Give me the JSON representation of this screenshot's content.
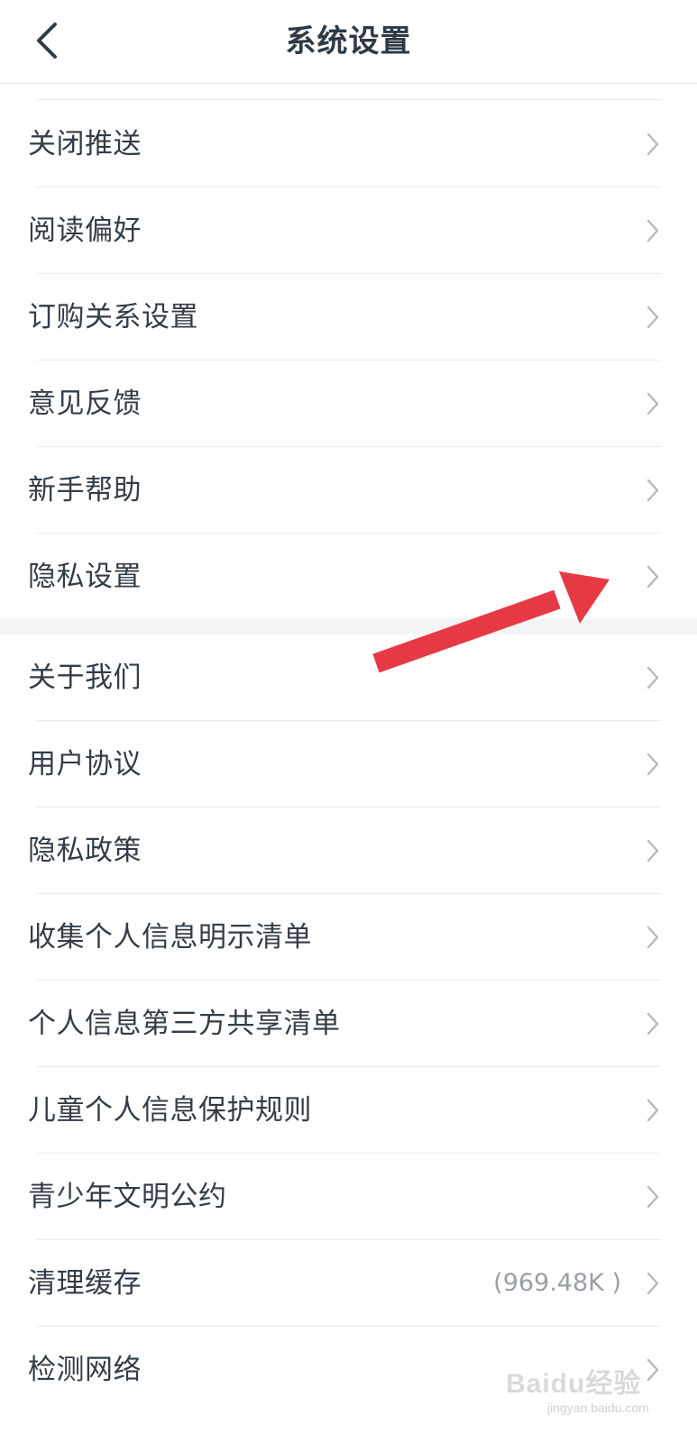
{
  "header": {
    "title": "系统设置",
    "back_icon": "chevron-left-icon"
  },
  "group1": {
    "items": [
      {
        "label": "关闭推送",
        "icon": "chevron-right-icon"
      },
      {
        "label": "阅读偏好",
        "icon": "chevron-right-icon"
      },
      {
        "label": "订购关系设置",
        "icon": "chevron-right-icon"
      },
      {
        "label": "意见反馈",
        "icon": "chevron-right-icon"
      },
      {
        "label": "新手帮助",
        "icon": "chevron-right-icon"
      },
      {
        "label": "隐私设置",
        "icon": "chevron-right-icon"
      }
    ]
  },
  "group2": {
    "items": [
      {
        "label": "关于我们",
        "icon": "chevron-right-icon"
      },
      {
        "label": "用户协议",
        "icon": "chevron-right-icon"
      },
      {
        "label": "隐私政策",
        "icon": "chevron-right-icon"
      },
      {
        "label": "收集个人信息明示清单",
        "icon": "chevron-right-icon"
      },
      {
        "label": "个人信息第三方共享清单",
        "icon": "chevron-right-icon"
      },
      {
        "label": "儿童个人信息保护规则",
        "icon": "chevron-right-icon"
      },
      {
        "label": "青少年文明公约",
        "icon": "chevron-right-icon"
      },
      {
        "label": "清理缓存",
        "value": "(969.48K )",
        "icon": "chevron-right-icon"
      },
      {
        "label": "检测网络",
        "icon": "chevron-right-icon"
      }
    ]
  },
  "annotation": {
    "arrow_color": "#e63946",
    "arrow_icon": "red-arrow-pointer"
  },
  "watermark": {
    "brand": "Baidu经验",
    "site": "jingyan.baidu.com"
  },
  "colors": {
    "text": "#333d47",
    "title": "#2f3a45",
    "divider": "#ececec",
    "section_gap": "#f3f4f5",
    "chevron": "#b5b9bd"
  }
}
